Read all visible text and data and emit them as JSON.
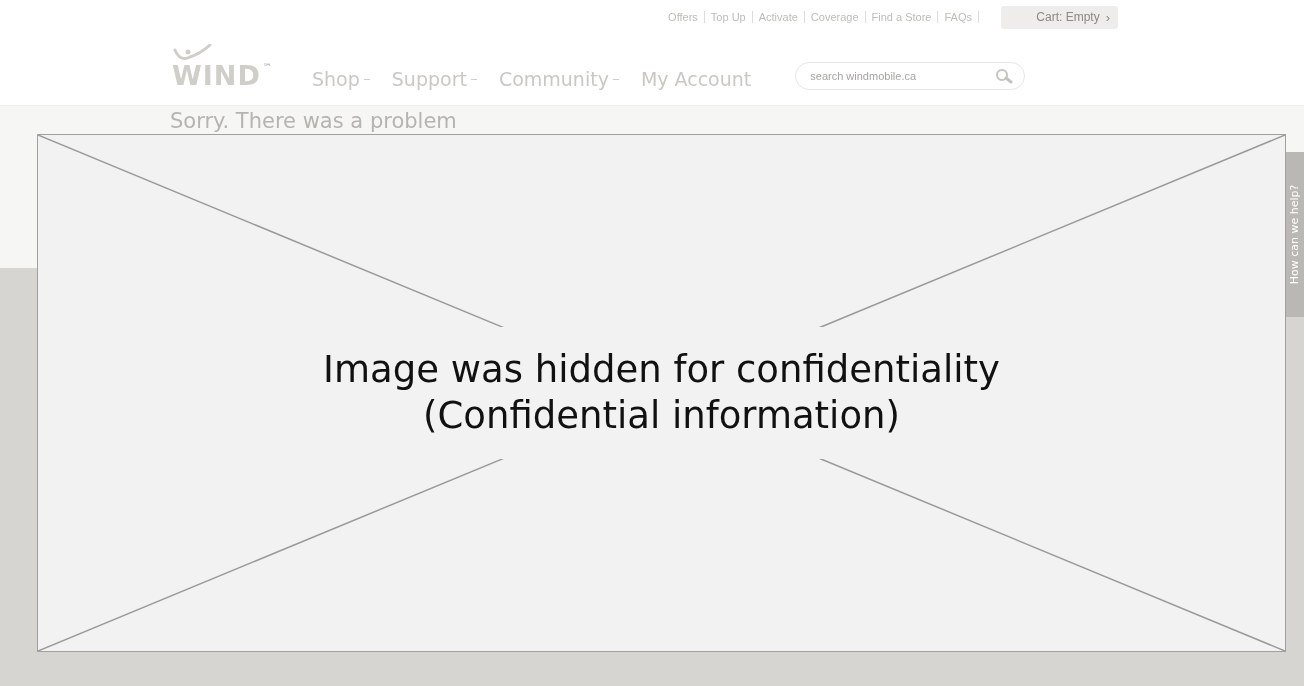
{
  "top_links": [
    "Offers",
    "Top Up",
    "Activate",
    "Coverage",
    "Find a Store",
    "FAQs"
  ],
  "cart": {
    "label": "Cart: Empty",
    "arrow": "›"
  },
  "logo": {
    "text": "WIND",
    "mark": "™"
  },
  "nav": [
    {
      "label": "Shop",
      "dropdown": true
    },
    {
      "label": "Support",
      "dropdown": true
    },
    {
      "label": "Community",
      "dropdown": true
    },
    {
      "label": "My Account",
      "dropdown": false
    }
  ],
  "search": {
    "placeholder": "search windmobile.ca"
  },
  "page_heading": "Sorry. There was a problem",
  "help_tab": {
    "label": "How can we help?"
  },
  "redaction": {
    "lines": [
      "Image was hidden for confidentiality",
      "(Confidential information)"
    ]
  }
}
